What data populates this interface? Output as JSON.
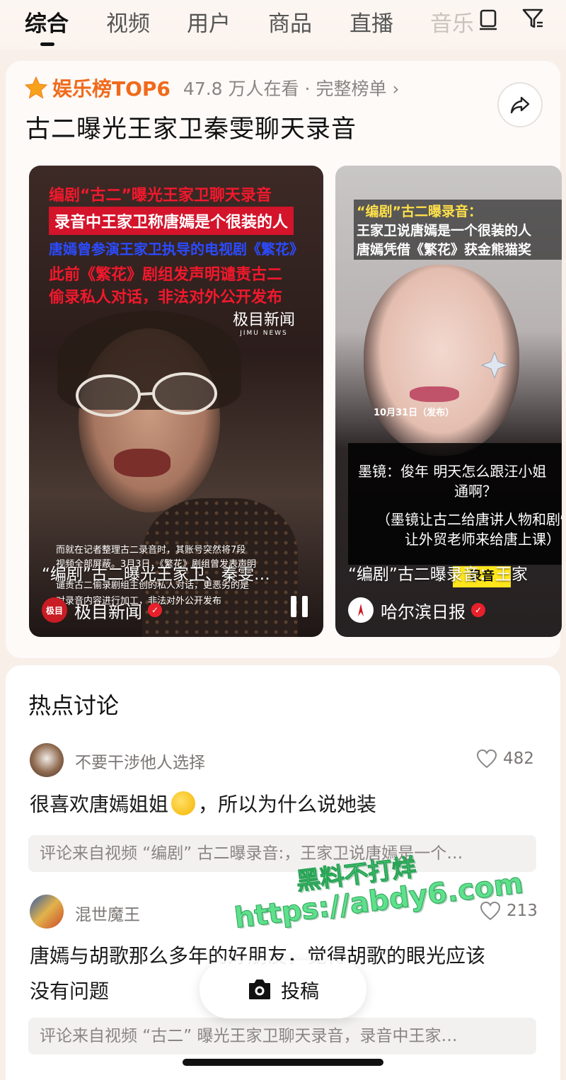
{
  "tabs": [
    {
      "label": "综合"
    },
    {
      "label": "视频"
    },
    {
      "label": "用户"
    },
    {
      "label": "商品"
    },
    {
      "label": "直播"
    },
    {
      "label": "音乐"
    }
  ],
  "hot": {
    "rank_label": "娱乐榜TOP6",
    "viewers": "47.8 万人在看",
    "full_list": "· 完整榜单 ›",
    "title": "古二曝光王家卫秦雯聊天录音"
  },
  "video1": {
    "cap1": "编剧“古二”曝光王家卫聊天录音",
    "cap2": "录音中王家卫称唐嫣是个很装的人",
    "cap3": "唐嫣曾参演王家卫执导的电视剧《繁花》",
    "cap4": "此前《繁花》剧组发声明谴责古二",
    "cap5": "偷录私人对话，非法对外公开发布",
    "logo_text": "极目新闻",
    "logo_sub": "JIMU NEWS",
    "sub1": "而就在记者整理古二录音时，其账号突然将7段",
    "sub2": "视频全部屏蔽。3月3日，《繁花》剧组曾发表声明",
    "sub3": "谴责古二偷录剧组主创的私人对话，更恶劣的是",
    "sub4": "对录音内容进行加工，非法对外公开发布",
    "overlay_title": "“编剧”古二曝光王家卫、秦雯…",
    "author_logo": "极目",
    "author": "极目新闻"
  },
  "video2": {
    "cap1": "“编剧”古二曝录音：",
    "cap2": "王家卫说唐嫣是一个很装的人",
    "cap3": "唐嫣凭借《繁花》获金熊猫奖",
    "date": "10月31日（发布）",
    "line1": "墨镜：俊年 明天怎么跟汪小姐",
    "line2": "通啊？",
    "line3": "（墨镜让古二给唐讲人物和剧情",
    "line4": "让外贸老师来给唐上课）",
    "yellow": "录音",
    "overlay_title": "“编剧”古二曝录音：王家",
    "author": "哈尔滨日报"
  },
  "discussion": {
    "title": "热点讨论",
    "comments": [
      {
        "user": "不要干涉他人选择",
        "likes": "482",
        "text_a": "很喜欢唐嫣姐姐",
        "text_b": "，所以为什么说她装",
        "source": "评论来自视频 “编剧” 古二曝录音:，王家卫说唐嫣是一个…"
      },
      {
        "user": "混世魔王",
        "likes": "213",
        "text_l1": "唐嫣与胡歌那么多年的好朋友，觉得胡歌的眼光应该",
        "text_l2": "没有问题",
        "source": "评论来自视频 “古二” 曝光王家卫聊天录音，录音中王家…"
      }
    ]
  },
  "post_button": "投稿",
  "watermark": {
    "line1": "黑料不打烊",
    "line2": "https://abdy6.com"
  },
  "colors": {
    "accent_orange": "#f06a1b",
    "watermark_green": "#5fe08c",
    "verified_red": "#e8202b"
  }
}
